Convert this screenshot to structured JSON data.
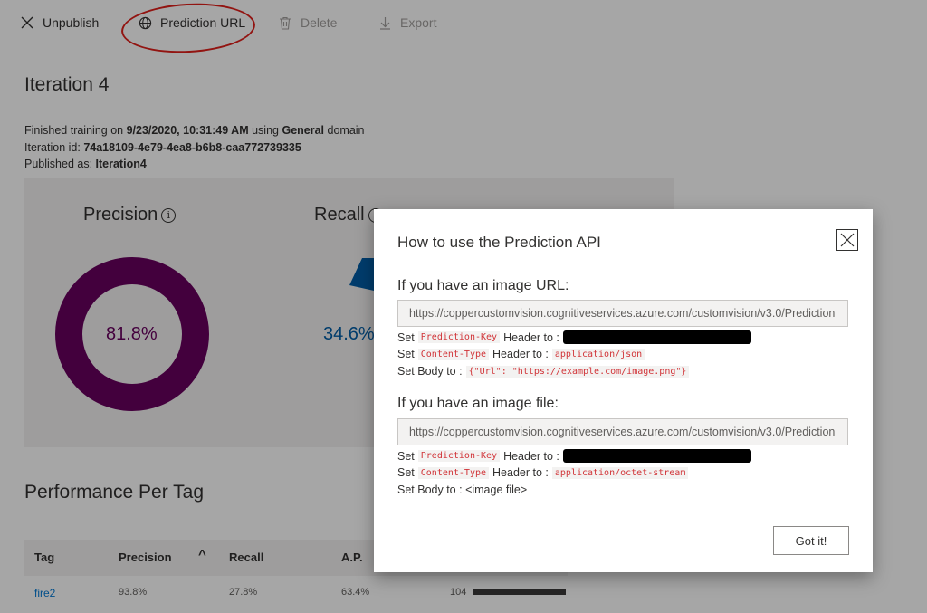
{
  "toolbar": {
    "unpublish": "Unpublish",
    "prediction_url": "Prediction URL",
    "delete": "Delete",
    "export": "Export"
  },
  "iteration": {
    "title": "Iteration 4",
    "finished_prefix": "Finished training on ",
    "finished_date": "9/23/2020, 10:31:49 AM",
    "using": " using ",
    "domain_name": "General",
    "domain_suffix": " domain",
    "id_label": "Iteration id: ",
    "id_value": "74a18109-4e79-4ea8-b6b8-caa772739335",
    "published_label": "Published as: ",
    "published_value": "Iteration4"
  },
  "metrics": {
    "precision_label": "Precision",
    "precision_value": "81.8%",
    "precision_fraction": 0.818,
    "precision_color": "#68005e",
    "recall_label": "Recall",
    "recall_value": "34.6%",
    "recall_color": "#005da6",
    "info_glyph": "i"
  },
  "perf": {
    "title": "Performance Per Tag",
    "headers": [
      "Tag",
      "Precision",
      "Recall",
      "A.P."
    ],
    "sort_glyph": "^",
    "rows": [
      {
        "tag": "fire2",
        "precision": "93.8%",
        "recall": "27.8%",
        "ap": "63.4%",
        "count": "104"
      }
    ]
  },
  "dialog": {
    "title": "How to use the Prediction API",
    "url_heading": "If you have an image URL:",
    "url_value": "https://coppercustomvision.cognitiveservices.azure.com/customvision/v3.0/Prediction",
    "file_heading": "If you have an image file:",
    "file_value": "https://coppercustomvision.cognitiveservices.azure.com/customvision/v3.0/Prediction",
    "set": "Set",
    "set_body": "Set Body to :",
    "header_to": "Header to :",
    "prediction_key": "Prediction-Key",
    "content_type": "Content-Type",
    "json_type": "application/json",
    "json_body": "{\"Url\": \"https://example.com/image.png\"}",
    "octet_type": "application/octet-stream",
    "file_body": "<image file>",
    "got_it": "Got it!"
  },
  "icons": {
    "unpublish": "close-icon",
    "prediction_url": "globe-icon",
    "delete": "trash-icon",
    "export": "download-icon",
    "dialog_close": "close-icon"
  }
}
